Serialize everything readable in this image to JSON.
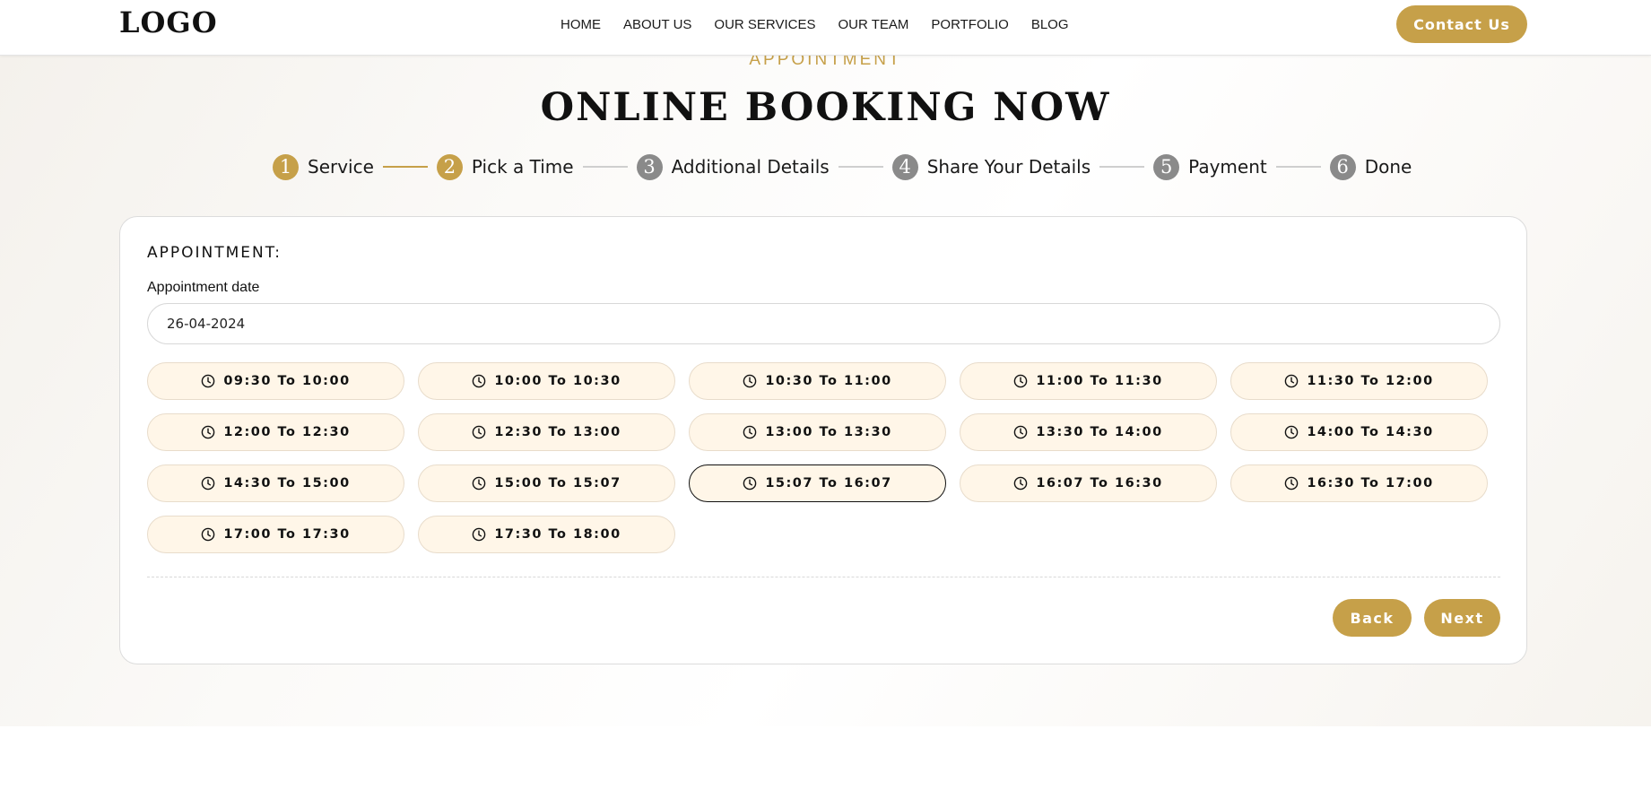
{
  "header": {
    "logo": "LOGO",
    "nav": [
      "HOME",
      "ABOUT US",
      "OUR SERVICES",
      "OUR TEAM",
      "PORTFOLIO",
      "BLOG"
    ],
    "contact_label": "Contact Us"
  },
  "hero": {
    "overline": "APPOINTMENT",
    "title": "ONLINE BOOKING NOW"
  },
  "steps": [
    {
      "num": "1",
      "label": "Service",
      "active": true
    },
    {
      "num": "2",
      "label": "Pick a Time",
      "active": true
    },
    {
      "num": "3",
      "label": "Additional Details",
      "active": false
    },
    {
      "num": "4",
      "label": "Share Your Details",
      "active": false
    },
    {
      "num": "5",
      "label": "Payment",
      "active": false
    },
    {
      "num": "6",
      "label": "Done",
      "active": false
    }
  ],
  "form": {
    "title": "APPOINTMENT:",
    "date_label": "Appointment date",
    "date_value": "26-04-2024",
    "selected_slot": "15:07 To 16:07",
    "slots": [
      "09:30 To 10:00",
      "10:00 To 10:30",
      "10:30 To 11:00",
      "11:00 To 11:30",
      "11:30 To 12:00",
      "12:00 To 12:30",
      "12:30 To 13:00",
      "13:00 To 13:30",
      "13:30 To 14:00",
      "14:00 To 14:30",
      "14:30 To 15:00",
      "15:00 To 15:07",
      "15:07 To 16:07",
      "16:07 To 16:30",
      "16:30 To 17:00",
      "17:00 To 17:30",
      "17:30 To 18:00"
    ],
    "back_label": "Back",
    "next_label": "Next"
  },
  "colors": {
    "accent": "#c6a049",
    "step_inactive": "#8a8a8a",
    "slot_bg": "#fff6e8"
  }
}
